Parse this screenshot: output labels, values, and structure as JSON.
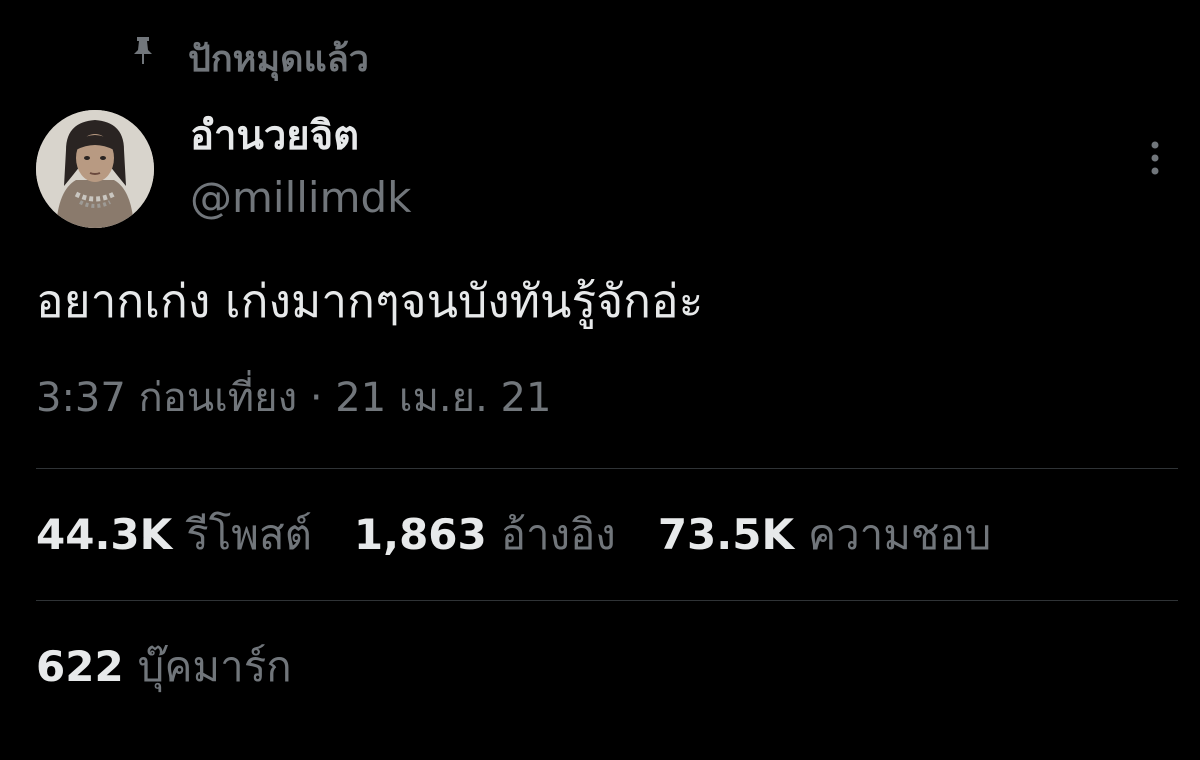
{
  "pinned": {
    "label": "ปักหมุดแล้ว",
    "icon": "pin-icon"
  },
  "author": {
    "display_name": "อำนวยจิต",
    "handle": "@millimdk",
    "avatar_icon": "avatar"
  },
  "tweet": {
    "text": "อยากเก่ง เก่งมากๆจนบังทันรู้จักอ่ะ",
    "timestamp": "3:37 ก่อนเที่ยง · 21 เม.ย. 21"
  },
  "stats": {
    "reposts_count": "44.3K",
    "reposts_label": "รีโพสต์",
    "quotes_count": "1,863",
    "quotes_label": "อ้างอิง",
    "likes_count": "73.5K",
    "likes_label": "ความชอบ",
    "bookmarks_count": "622",
    "bookmarks_label": "บุ๊คมาร์ก"
  },
  "more_button_icon": "more-vertical-icon",
  "colors": {
    "background": "#000000",
    "primary_text": "#e7e9ea",
    "secondary_text": "#71767b",
    "divider": "#2f3336"
  }
}
